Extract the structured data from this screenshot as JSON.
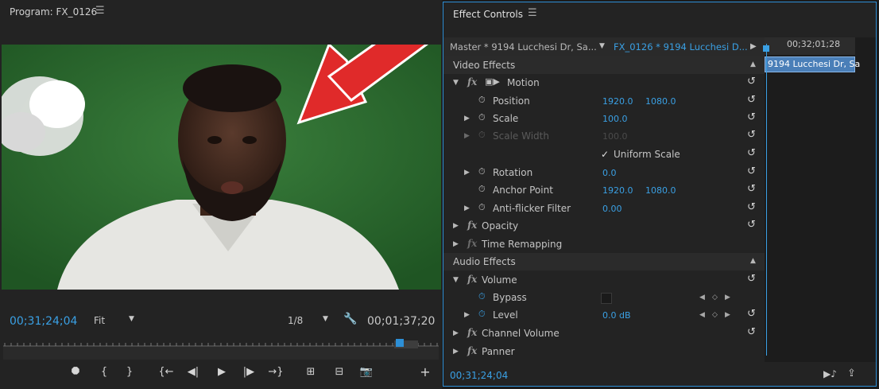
{
  "program": {
    "title": "Program: FX_0126",
    "menu_icon": "hamburger-icon",
    "timecode_left": "00;31;24;04",
    "fit_value": "Fit",
    "resolution_value": "1/8",
    "timecode_right": "00;01;37;20",
    "transport": [
      "marker-icon",
      "mark-in-icon",
      "mark-out-icon",
      "go-to-in-icon",
      "step-back-icon",
      "play-icon",
      "step-forward-icon",
      "go-to-out-icon",
      "lift-icon",
      "extract-icon",
      "export-frame-icon",
      "add-button-icon"
    ]
  },
  "effect_controls": {
    "title": "Effect Controls",
    "master_clip": "Master * 9194 Lucchesi Dr, Sa...",
    "sequence_clip": "FX_0126 * 9194 Lucchesi D...",
    "timeline_timecode": "00;32;01;28",
    "timeline_clip": "9194 Lucchesi Dr, Sa",
    "video_section": "Video Effects",
    "audio_section": "Audio Effects",
    "motion": "Motion",
    "position": "Position",
    "position_x": "1920.0",
    "position_y": "1080.0",
    "scale": "Scale",
    "scale_value": "100.0",
    "scale_width": "Scale Width",
    "scale_width_value": "100.0",
    "uniform_scale": "Uniform Scale",
    "rotation": "Rotation",
    "rotation_value": "0.0",
    "anchor_point": "Anchor Point",
    "anchor_x": "1920.0",
    "anchor_y": "1080.0",
    "anti_flicker": "Anti-flicker Filter",
    "anti_flicker_value": "0.00",
    "opacity": "Opacity",
    "time_remapping": "Time Remapping",
    "volume": "Volume",
    "bypass": "Bypass",
    "level": "Level",
    "level_value": "0.0 dB",
    "channel_volume": "Channel Volume",
    "panner": "Panner",
    "footer_timecode": "00;31;24;04"
  },
  "colors": {
    "accent": "#3aa0e4",
    "green_screen": "#2c6a2f",
    "arrow": "#e02a2a"
  }
}
